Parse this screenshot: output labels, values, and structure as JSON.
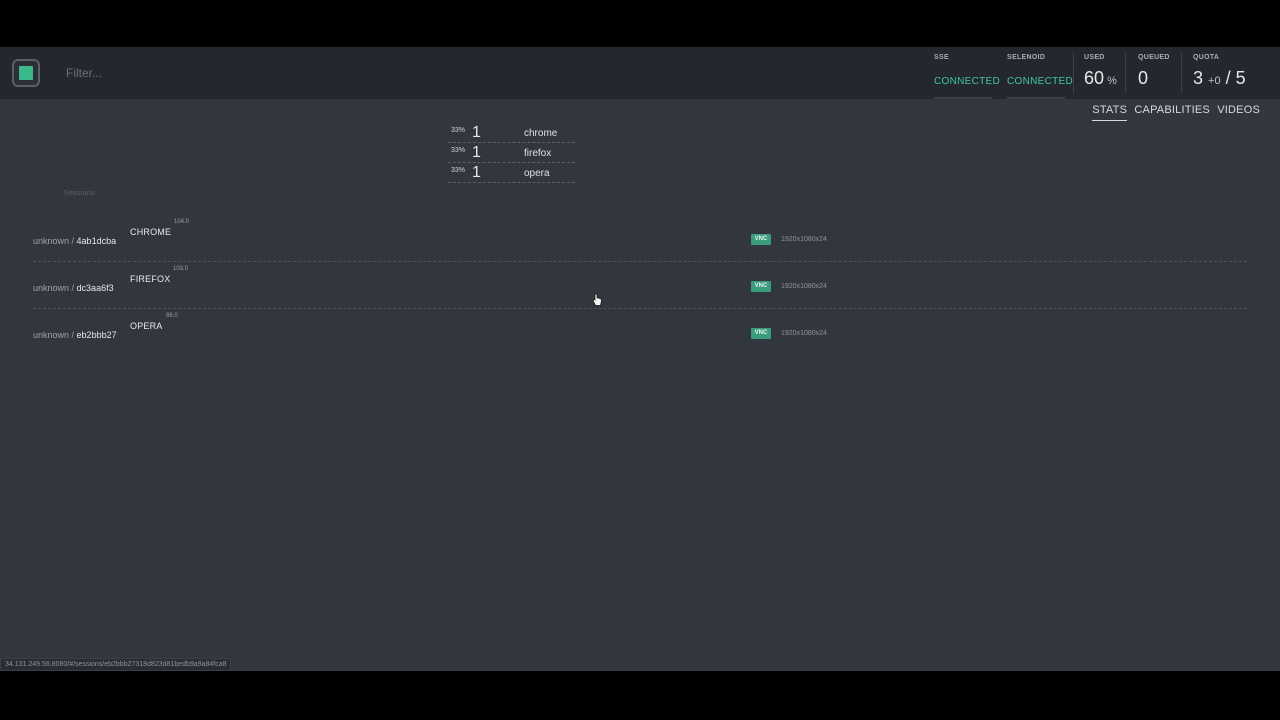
{
  "filter": {
    "placeholder": "Filter..."
  },
  "status": {
    "sse": {
      "label": "SSE",
      "value": "CONNECTED"
    },
    "selenoid": {
      "label": "SELENOID",
      "value": "CONNECTED"
    },
    "used": {
      "label": "USED",
      "value": "60",
      "unit": "%"
    },
    "queued": {
      "label": "QUEUED",
      "value": "0"
    },
    "quota": {
      "label": "QUOTA",
      "used": "3",
      "plus": "+",
      "pending": "0",
      "slash": "/",
      "total": "5"
    }
  },
  "tabs": [
    "STATS",
    "CAPABILITIES",
    "VIDEOS"
  ],
  "summary": [
    {
      "pct": "33%",
      "count": "1",
      "name": "chrome"
    },
    {
      "pct": "33%",
      "count": "1",
      "name": "firefox"
    },
    {
      "pct": "33%",
      "count": "1",
      "name": "opera"
    }
  ],
  "sessions_label": "Sessions",
  "sessions": [
    {
      "owner": "unknown",
      "sep": " / ",
      "id": "4ab1dcba",
      "browser": "CHROME",
      "version": "104.0",
      "vnc": "VNC",
      "resolution": "1920x1080x24"
    },
    {
      "owner": "unknown",
      "sep": " / ",
      "id": "dc3aa6f3",
      "browser": "FIREFOX",
      "version": "103.0",
      "vnc": "VNC",
      "resolution": "1920x1080x24"
    },
    {
      "owner": "unknown",
      "sep": " / ",
      "id": "eb2bbb27",
      "browser": "OPERA",
      "version": "86.0",
      "vnc": "VNC",
      "resolution": "1920x1080x24"
    }
  ],
  "statusbar_url": "34.131.249.56:8080/#/sessions/eb2bbb27318d823d81bedb9a9a84fca8",
  "colors": {
    "accent": "#3fc79a",
    "background": "#32363f",
    "topbar": "#24272d",
    "vnc_badge": "#3b9c7d"
  }
}
